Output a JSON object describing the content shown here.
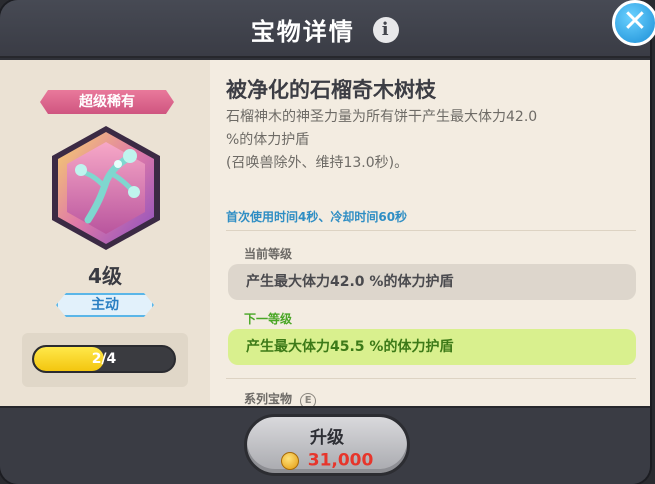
{
  "header": {
    "title": "宝物详情",
    "info_icon": "i",
    "close_icon": "✕"
  },
  "left": {
    "rarity": "超级稀有",
    "level": "4级",
    "type": "主动",
    "progress": {
      "text": "2/4",
      "current": 2,
      "max": 4
    },
    "colors": {
      "rarity": "#d9628a",
      "progress_fill": "#f8d22a"
    }
  },
  "right": {
    "name": "被净化的石榴奇木树枝",
    "desc_line1": "石榴神木的神圣力量为所有饼干产生最大体力42.0",
    "desc_line2": "%的体力护盾",
    "desc_line3": "(召唤兽除外、维持13.0秒)。",
    "cooldown": "首次使用时间4秒、冷却时间60秒",
    "current_label": "当前等级",
    "current_effect": "产生最大体力42.0 %的体力护盾",
    "next_label": "下一等级",
    "next_effect": "产生最大体力45.5 %的体力护盾",
    "series_label": "系列宝物",
    "series_icon": "E"
  },
  "footer": {
    "upgrade_label": "升级",
    "cost": "31,000",
    "colors": {
      "cost": "#e7352b"
    }
  }
}
